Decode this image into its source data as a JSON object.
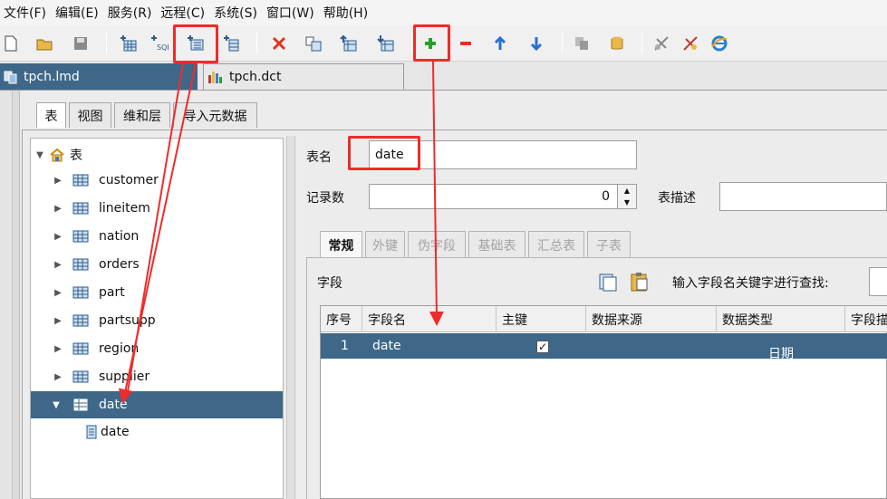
{
  "menu": [
    "文件(F)",
    "编辑(E)",
    "服务(R)",
    "远程(C)",
    "系统(S)",
    "窗口(W)",
    "帮助(H)"
  ],
  "doc_tabs": [
    "tpch.lmd",
    "tpch.dct"
  ],
  "editor_tabs": [
    "表",
    "视图",
    "维和层",
    "导入元数据"
  ],
  "tree": {
    "root": "表",
    "tables": [
      "customer",
      "lineitem",
      "nation",
      "orders",
      "part",
      "partsupp",
      "region",
      "supplier"
    ],
    "selected": "date",
    "child": "date"
  },
  "detail": {
    "name_label": "表名",
    "name_value": "date",
    "records_label": "记录数",
    "records_value": "0",
    "desc_label": "表描述",
    "desc_value": ""
  },
  "sub_tabs": [
    "常规",
    "外键",
    "伪字段",
    "基础表",
    "汇总表",
    "子表"
  ],
  "fields": {
    "label": "字段",
    "search_label": "输入字段名关键字进行查找:",
    "search_value": "",
    "columns": [
      "序号",
      "字段名",
      "主键",
      "数据来源",
      "数据类型",
      "字段描"
    ],
    "row": {
      "index": "1",
      "name": "date",
      "primary_key": true,
      "source": "",
      "type": "日期"
    }
  },
  "colors": {
    "selection": "#3e6788",
    "annotation": "#f02b2b"
  }
}
